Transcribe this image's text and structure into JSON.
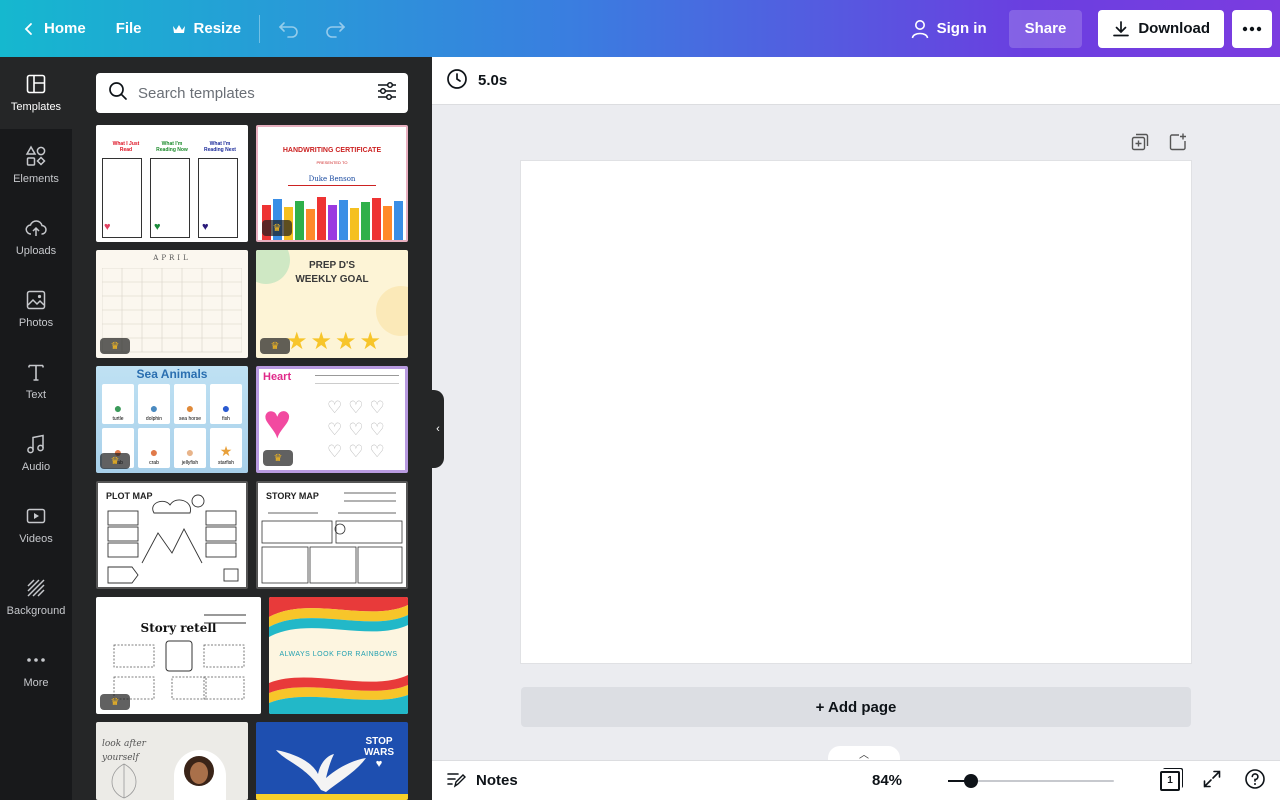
{
  "topbar": {
    "home_label": "Home",
    "file_label": "File",
    "resize_label": "Resize",
    "signin_label": "Sign in",
    "share_label": "Share",
    "download_label": "Download"
  },
  "rail": {
    "items": [
      {
        "label": "Templates",
        "icon": "templates-icon"
      },
      {
        "label": "Elements",
        "icon": "elements-icon"
      },
      {
        "label": "Uploads",
        "icon": "uploads-icon"
      },
      {
        "label": "Photos",
        "icon": "photos-icon"
      },
      {
        "label": "Text",
        "icon": "text-icon"
      },
      {
        "label": "Audio",
        "icon": "audio-icon"
      },
      {
        "label": "Videos",
        "icon": "videos-icon"
      },
      {
        "label": "Background",
        "icon": "background-icon"
      },
      {
        "label": "More",
        "icon": "more-icon"
      }
    ]
  },
  "panel": {
    "search_placeholder": "Search templates",
    "templates": [
      {
        "name": "reading-log",
        "headers": [
          "What I Just Read",
          "What I'm Reading Now",
          "What I'm Reading Next"
        ],
        "premium": false
      },
      {
        "name": "handwriting-certificate",
        "title": "HANDWRITING CERTIFICATE",
        "subtitle": "PRESENTED TO",
        "recipient": "Duke Benson",
        "premium": true
      },
      {
        "name": "april-calendar",
        "title": "APRIL",
        "premium": true
      },
      {
        "name": "weekly-goal",
        "title_line1": "PREP D'S",
        "title_line2": "WEEKLY GOAL",
        "premium": true
      },
      {
        "name": "sea-animals",
        "title": "Sea Animals",
        "animals": [
          "turtle",
          "dolphin",
          "sea horse",
          "fish",
          "crab",
          "crab",
          "jellyfish",
          "starfish"
        ],
        "premium": true
      },
      {
        "name": "heart-worksheet",
        "title": "Heart",
        "premium": true
      },
      {
        "name": "plot-map",
        "title": "PLOT MAP",
        "premium": false
      },
      {
        "name": "story-map",
        "title": "STORY MAP",
        "premium": false
      },
      {
        "name": "story-retell",
        "title": "Story retell",
        "premium": true
      },
      {
        "name": "rainbows",
        "title": "ALWAYS LOOK FOR RAINBOWS",
        "premium": false
      },
      {
        "name": "look-after-yourself",
        "title": "look after yourself",
        "premium": false
      },
      {
        "name": "stop-wars",
        "title_line1": "STOP",
        "title_line2": "WARS",
        "premium": false
      }
    ]
  },
  "toolbar": {
    "duration": "5.0s"
  },
  "canvas": {
    "add_page_label": "+ Add page"
  },
  "footer": {
    "notes_label": "Notes",
    "zoom_label": "84%",
    "zoom_fraction": 0.14,
    "page_count": "1"
  },
  "colors": {
    "gradient_start": "#15b8cf",
    "gradient_end": "#7b3ce0",
    "rail_bg": "#18191b",
    "panel_bg": "#252627"
  }
}
